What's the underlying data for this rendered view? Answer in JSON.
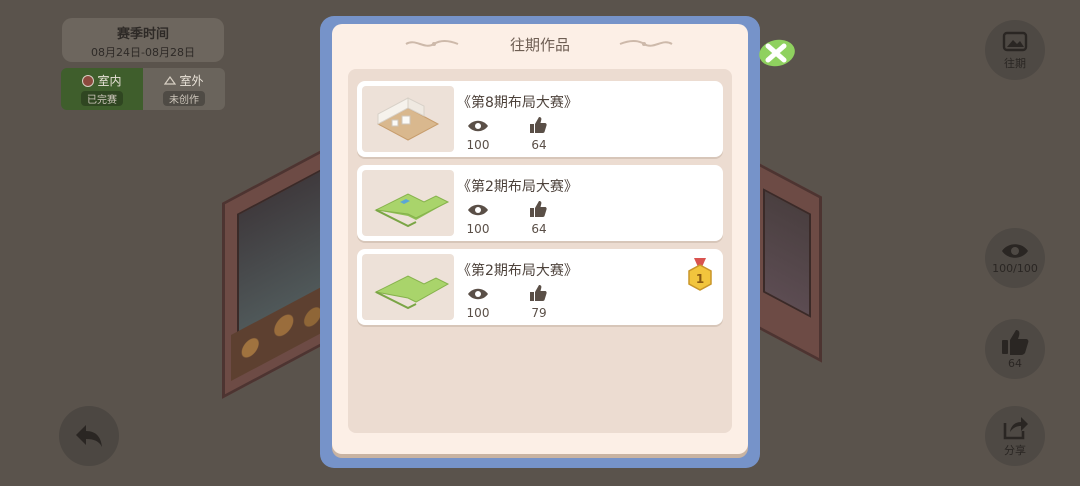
{
  "season": {
    "title": "赛季时间",
    "dates": "08月24日-08月28日"
  },
  "tabs": [
    {
      "name": "室内",
      "status": "已完赛"
    },
    {
      "name": "室外",
      "status": "未创作"
    }
  ],
  "side_buttons": {
    "history_label": "往期",
    "views_label": "100/100",
    "likes_label": "64",
    "share_label": "分享"
  },
  "modal": {
    "title": "往期作品",
    "entries": [
      {
        "title": "《第8期布局大赛》",
        "views": "100",
        "likes": "64",
        "medal": false
      },
      {
        "title": "《第2期布局大赛》",
        "views": "100",
        "likes": "64",
        "medal": false
      },
      {
        "title": "《第2期布局大赛》",
        "views": "100",
        "likes": "79",
        "medal": true
      }
    ]
  },
  "colors": {
    "frame_blue": "#7693c9",
    "panel_cream": "#fcefe6",
    "grass_green": "#9fcf6a",
    "close_leaf": "#8fd15f",
    "medal_gold": "#f2c53d"
  },
  "icons": {
    "view": "eye-icon",
    "like": "thumbs-up-icon",
    "close": "close-icon",
    "back": "back-arrow-icon",
    "share": "share-icon",
    "history": "gallery-icon",
    "medal": "medal-icon"
  }
}
